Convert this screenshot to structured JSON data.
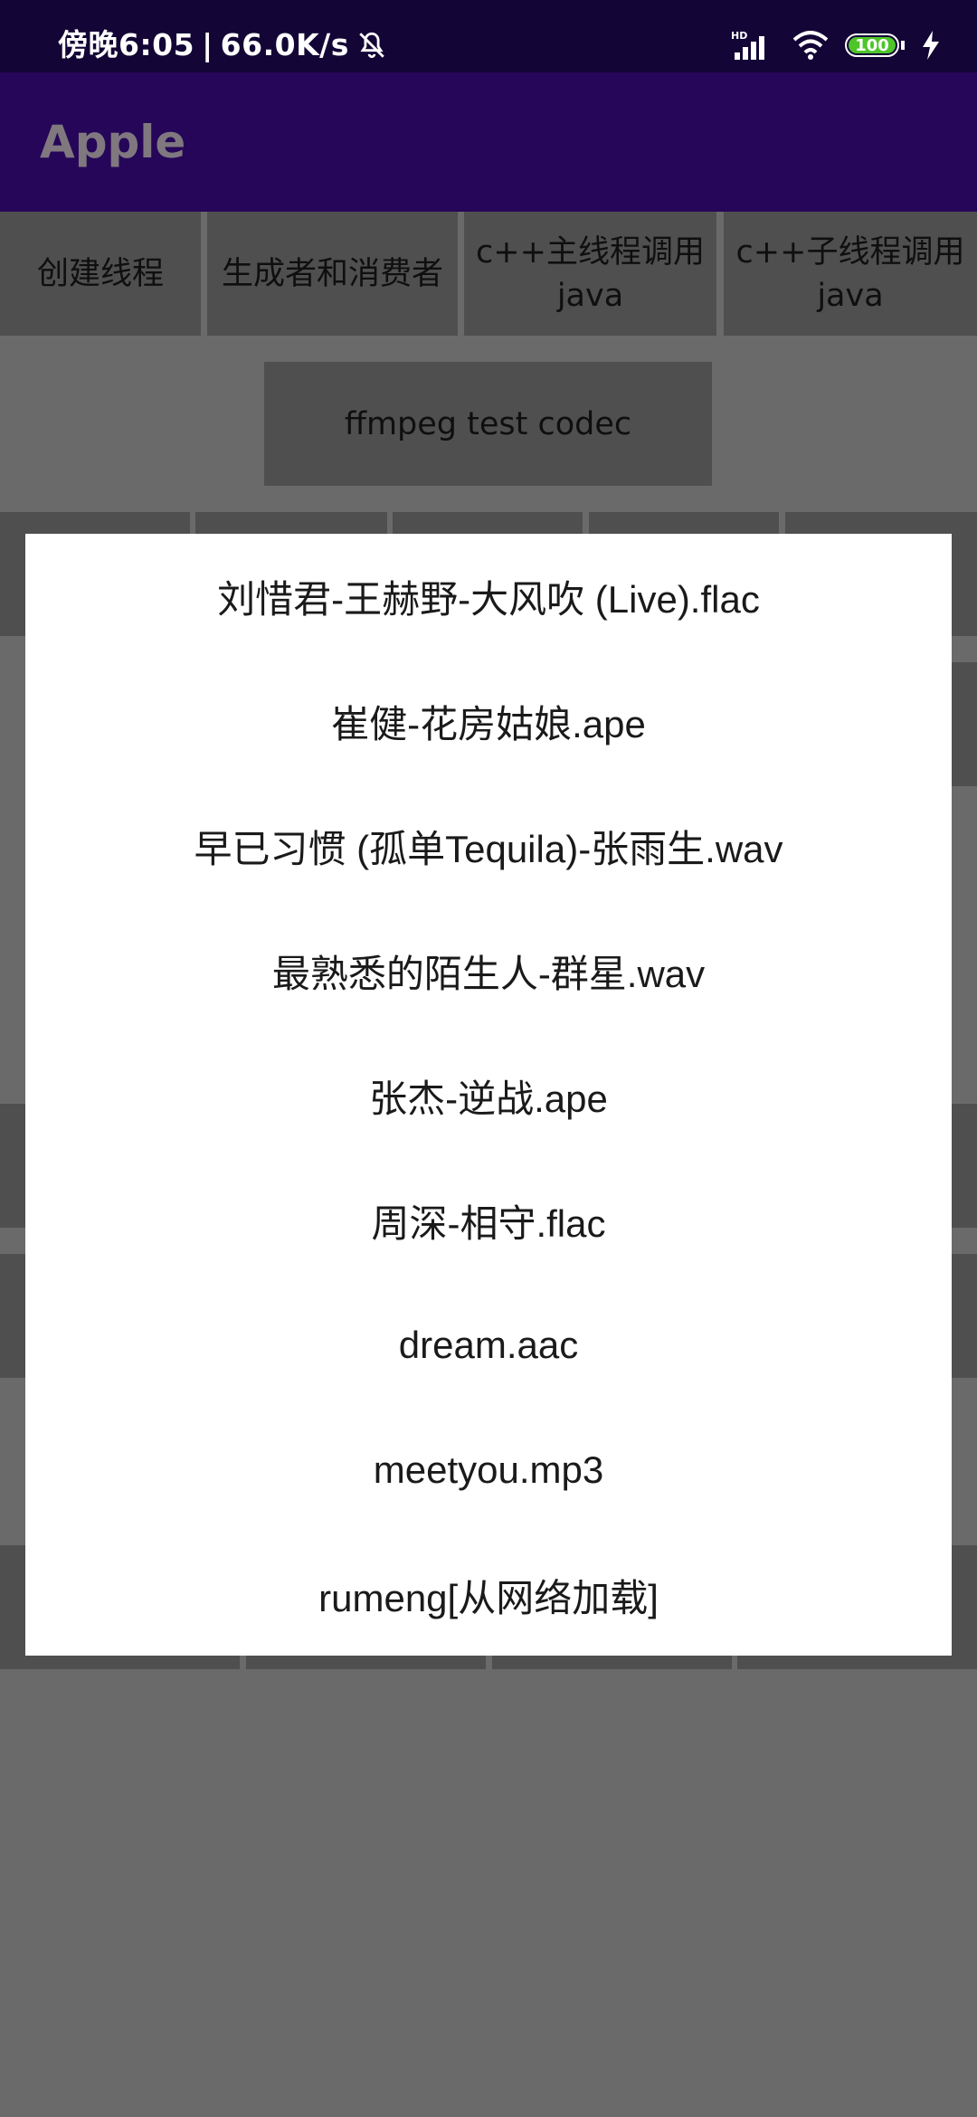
{
  "status_bar": {
    "time": "傍晚6:05",
    "network_speed": "66.0K/s",
    "battery_level": "100",
    "icons": [
      "mute-icon",
      "hd-signal-icon",
      "wifi-icon",
      "battery-icon",
      "charging-icon"
    ]
  },
  "app_bar": {
    "title": "Apple"
  },
  "buttons": {
    "create_thread": "创建线程",
    "producer_consumer": "生成者和消费者",
    "cpp_main_java_1": "c++主线程调用",
    "cpp_main_java_2": "java",
    "cpp_child_java_1": "c++子线程调用",
    "cpp_child_java_2": "java",
    "ffmpeg_test": "ffmpeg test codec"
  },
  "dialog": {
    "items": [
      "刘惜君-王赫野-大风吹 (Live).flac",
      "崔健-花房姑娘.ape",
      "早已习惯 (孤单Tequila)-张雨生.wav",
      "最熟悉的陌生人-群星.wav",
      "张杰-逆战.ape",
      "周深-相守.flac",
      "dream.aac",
      "meetyou.mp3",
      "rumeng[从网络加载]"
    ]
  },
  "colors": {
    "status_bar_bg": "#130535",
    "app_bar_bg": "#260659",
    "scrim": "#6a6a6a",
    "button_bg": "#4f4f4f",
    "dialog_bg": "#ffffff",
    "battery_green": "#4ec52b"
  }
}
